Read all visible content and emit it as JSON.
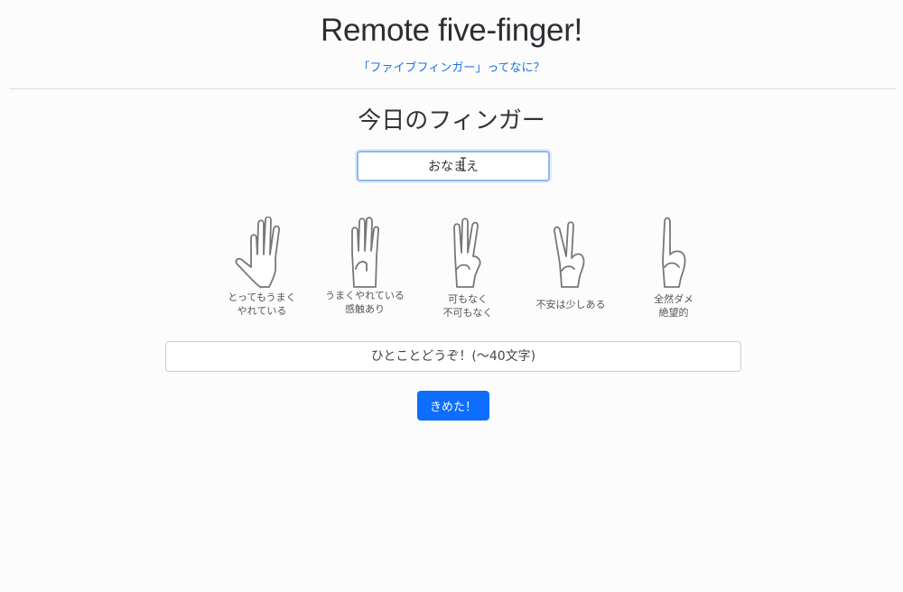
{
  "header": {
    "title": "Remote five-finger!",
    "about_link": "「ファイブフィンガー」ってなに？"
  },
  "main": {
    "section_title": "今日のフィンガー",
    "name_input": {
      "value": "おなまえ",
      "placeholder": "おなまえ"
    },
    "fingers": [
      {
        "count": 5,
        "label": "とってもうまく\nやれている",
        "icon": "five-fingers-hand-icon"
      },
      {
        "count": 4,
        "label": "うまくやれている\n感触あり",
        "icon": "four-fingers-hand-icon"
      },
      {
        "count": 3,
        "label": "可もなく\n不可もなく",
        "icon": "three-fingers-hand-icon"
      },
      {
        "count": 2,
        "label": "不安は少しある",
        "icon": "two-fingers-hand-icon"
      },
      {
        "count": 1,
        "label": "全然ダメ\n絶望的",
        "icon": "one-finger-hand-icon"
      }
    ],
    "comment_input": {
      "value": "",
      "placeholder": "ひとことどうぞ！(〜40文字)"
    },
    "submit_label": "きめた！"
  },
  "colors": {
    "link": "#1a73e8",
    "primary_button": "#0d6efd",
    "focus_border": "#8fb8ef"
  }
}
